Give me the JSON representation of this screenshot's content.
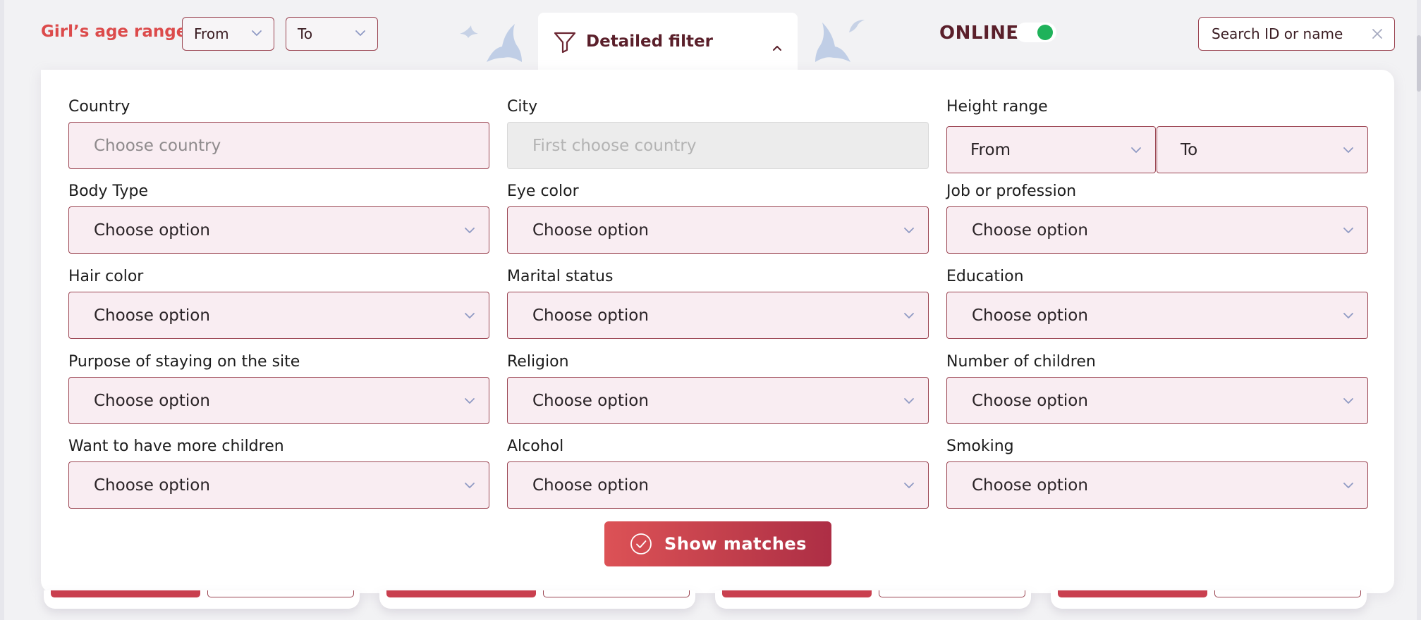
{
  "top_bar": {
    "age_range_label": "Girl’s age range",
    "age_from": "From",
    "age_to": "To",
    "detailed_filter_label": "Detailed filter",
    "online_label": "ONLINE",
    "online_enabled": true,
    "search_placeholder": "Search ID or name"
  },
  "filters": {
    "country": {
      "label": "Country",
      "placeholder": "Choose country"
    },
    "city": {
      "label": "City",
      "placeholder": "First choose country"
    },
    "height": {
      "label": "Height range",
      "from": "From",
      "to": "To"
    },
    "body_type": {
      "label": "Body Type",
      "value": "Choose option"
    },
    "eye_color": {
      "label": "Eye color",
      "value": "Choose option"
    },
    "job": {
      "label": "Job or profession",
      "value": "Choose option"
    },
    "hair_color": {
      "label": "Hair color",
      "value": "Choose option"
    },
    "marital_status": {
      "label": "Marital status",
      "value": "Choose option"
    },
    "education": {
      "label": "Education",
      "value": "Choose option"
    },
    "purpose": {
      "label": "Purpose of staying on the site",
      "value": "Choose option"
    },
    "religion": {
      "label": "Religion",
      "value": "Choose option"
    },
    "children_count": {
      "label": "Number of children",
      "value": "Choose option"
    },
    "more_children": {
      "label": "Want to have more children",
      "value": "Choose option"
    },
    "alcohol": {
      "label": "Alcohol",
      "value": "Choose option"
    },
    "smoking": {
      "label": "Smoking",
      "value": "Choose option"
    }
  },
  "show_matches_label": "Show matches",
  "icons": {
    "funnel": "funnel-icon",
    "caret_up": "caret-up-icon",
    "chevron": "chevron-down-icon",
    "clear": "close-icon",
    "check": "check-circle-icon",
    "decoration": "bat-icon"
  },
  "colors": {
    "accent": "#dc4b4b",
    "field_border": "#9b4552",
    "field_bg": "#f9edf2",
    "online_green": "#1fb25a",
    "title_text": "#5a1f2a"
  }
}
